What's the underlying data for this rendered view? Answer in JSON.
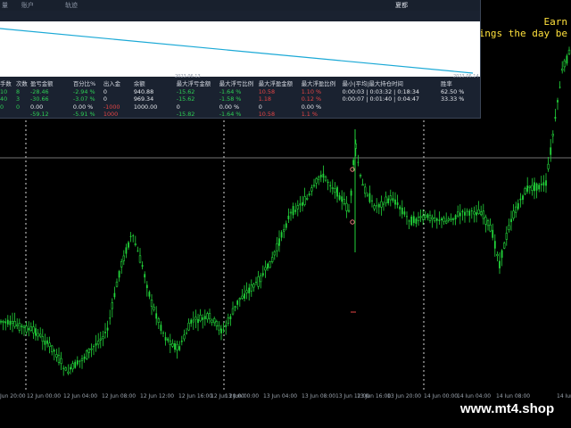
{
  "annotations": {
    "line1": "Earn",
    "line2": "arnings the day be"
  },
  "x_axis_labels": [
    "Jun 20:00",
    "12 Jun 00:00",
    "12 Jun 04:00",
    "12 Jun 08:00",
    "12 Jun 12:00",
    "12 Jun 16:00",
    "12 Jun 20:00",
    "13 Jun 00:00",
    "13 Jun 04:00",
    "13 Jun 08:00",
    "13 Jun 12:00",
    "13 Jun 16:00",
    "13 Jun 20:00",
    "14 Jun 00:00",
    "14 Jun 04:00",
    "14 Jun 08:00",
    "14 Jun"
  ],
  "watermark": "www.mt4.shop",
  "colors": {
    "bull_candle": "#22d43a",
    "equity_line": "#1ba9d6",
    "annotation": "#ffe13c",
    "panel_bg": "#1a2230"
  },
  "panel": {
    "title": "夏都",
    "tabs": [
      "量",
      "账户",
      "轨迹"
    ],
    "date_left": "2023.06.13",
    "date_right": "2023.06.14",
    "headers": [
      "手数",
      "次数",
      "盈亏金额",
      "百分比%",
      "出入金",
      "余额",
      "最大浮亏金额",
      "最大浮亏比例",
      "最大浮盈金额",
      "最大浮盈比例",
      "最小|平均|最大持仓时间",
      "",
      "胜率"
    ],
    "rows": [
      [
        "10",
        "8",
        "-28.46",
        "-2.94 %",
        "0",
        "940.88",
        "-15.62",
        "-1.64 %",
        "10.58",
        "1.10 %",
        "0:00:03 | 0:03:32 | 0:18:34",
        "",
        "62.50 %"
      ],
      [
        "40",
        "3",
        "-30.66",
        "-3.07 %",
        "0",
        "969.34",
        "-15.62",
        "-1.58 %",
        "1.18",
        "0.12 %",
        "0:00:07 | 0:01:40 | 0:04:47",
        "",
        "33.33 %"
      ],
      [
        "0",
        "0",
        "0.00",
        "0.00 %",
        "-1000",
        "1000.00",
        "0",
        "0.00 %",
        "0",
        "0.00 %",
        "",
        "",
        ""
      ],
      [
        "",
        "",
        "-59.12",
        "-5.91 %",
        "1000",
        "",
        "-15.82",
        "-1.64 %",
        "10.58",
        "1.1 %",
        "",
        "",
        ""
      ]
    ]
  }
}
